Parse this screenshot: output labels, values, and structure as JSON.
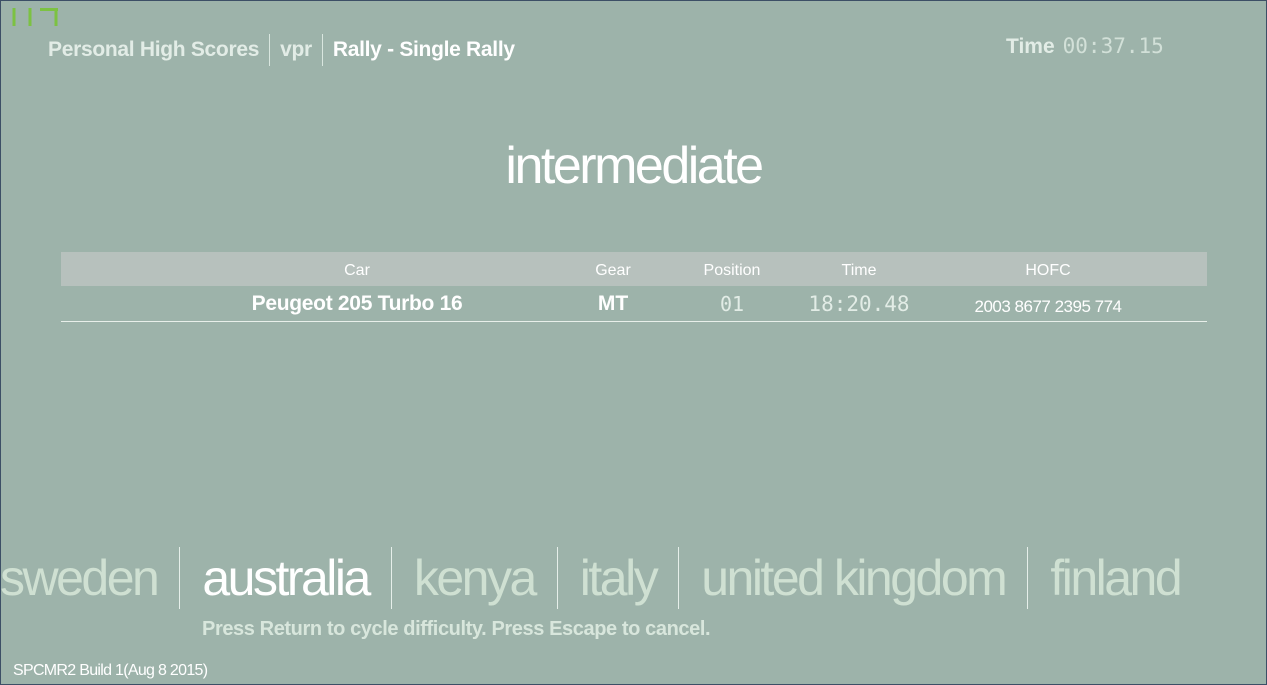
{
  "header": {
    "crumbs": [
      "Personal High Scores",
      "vpr",
      "Rally - Single Rally"
    ]
  },
  "timer": {
    "label": "Time",
    "value": "00:37.15"
  },
  "difficulty": "intermediate",
  "table": {
    "columns": [
      "Car",
      "Gear",
      "Position",
      "Time",
      "HOFC"
    ],
    "rows": [
      {
        "car": "Peugeot 205 Turbo 16",
        "gear": "MT",
        "position": "01",
        "time": "18:20.48",
        "hofc": "2003 8677 2395 774"
      }
    ]
  },
  "regions": {
    "items": [
      "sweden",
      "australia",
      "kenya",
      "italy",
      "united kingdom",
      "finland"
    ],
    "selected": "australia"
  },
  "hint": "Press Return to cycle difficulty. Press Escape to cancel.",
  "build": "SPCMR2 Build 1(Aug  8 2015)",
  "colors": {
    "background": "#9db3aa",
    "logo_green": "#7cc242",
    "header_bar": "#b7c1bd"
  }
}
